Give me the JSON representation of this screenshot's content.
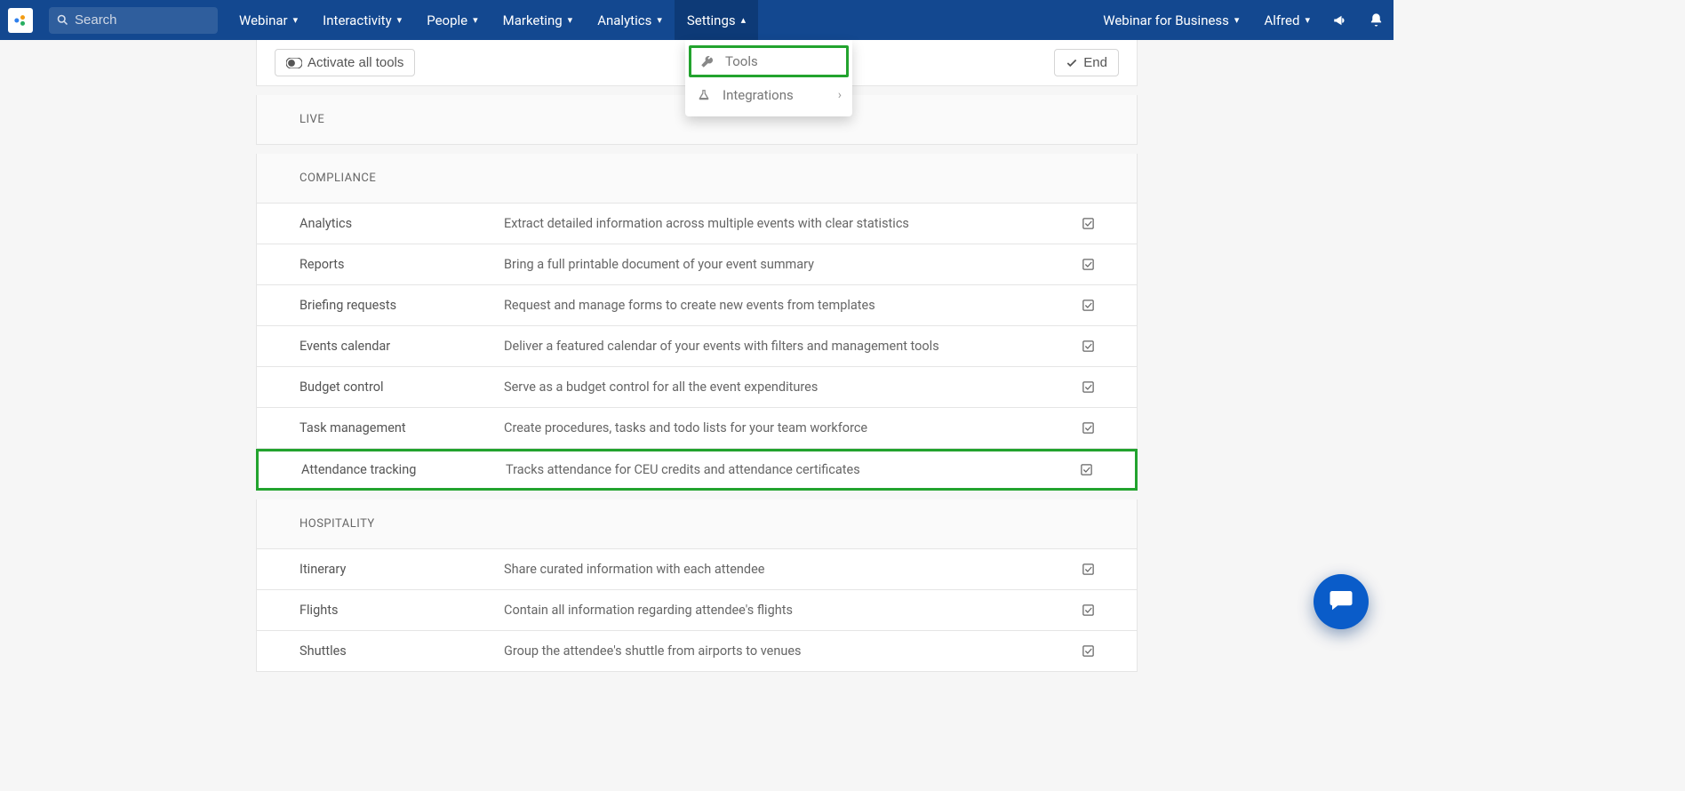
{
  "nav": {
    "search_placeholder": "Search",
    "items": [
      "Webinar",
      "Interactivity",
      "People",
      "Marketing",
      "Analytics",
      "Settings"
    ],
    "active_index": 5,
    "workspace": "Webinar for Business",
    "user": "Alfred"
  },
  "settings_dropdown": {
    "items": [
      {
        "label": "Tools",
        "icon": "wrench",
        "highlight": true
      },
      {
        "label": "Integrations",
        "icon": "flask",
        "submenu": true
      }
    ]
  },
  "top_actions": {
    "activate_all_label": "Activate all tools",
    "end_label": "End"
  },
  "sections": [
    {
      "title": "LIVE",
      "rows": []
    },
    {
      "title": "COMPLIANCE",
      "rows": [
        {
          "name": "Analytics",
          "desc": "Extract detailed information across multiple events with clear statistics",
          "checked": true
        },
        {
          "name": "Reports",
          "desc": "Bring a full printable document of your event summary",
          "checked": true
        },
        {
          "name": "Briefing requests",
          "desc": "Request and manage forms to create new events from templates",
          "checked": true
        },
        {
          "name": "Events calendar",
          "desc": "Deliver a featured calendar of your events with filters and management tools",
          "checked": true
        },
        {
          "name": "Budget control",
          "desc": "Serve as a budget control for all the event expenditures",
          "checked": true
        },
        {
          "name": "Task management",
          "desc": "Create procedures, tasks and todo lists for your team workforce",
          "checked": true
        },
        {
          "name": "Attendance tracking",
          "desc": "Tracks attendance for CEU credits and attendance certificates",
          "checked": true,
          "highlight": true
        }
      ]
    },
    {
      "title": "HOSPITALITY",
      "rows": [
        {
          "name": "Itinerary",
          "desc": "Share curated information with each attendee",
          "checked": true
        },
        {
          "name": "Flights",
          "desc": "Contain all information regarding attendee's flights",
          "checked": true
        },
        {
          "name": "Shuttles",
          "desc": "Group the attendee's shuttle from airports to venues",
          "checked": true
        }
      ]
    }
  ]
}
